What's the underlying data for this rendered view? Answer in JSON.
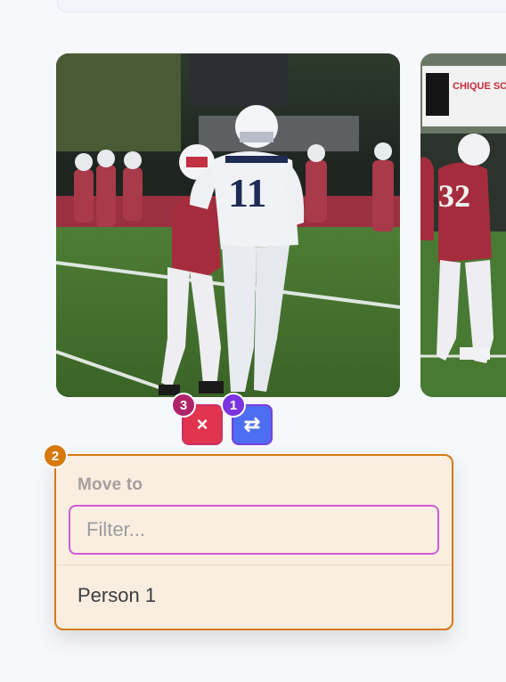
{
  "gallery": {
    "photos": [
      {
        "icon": "football-players-photo"
      },
      {
        "icon": "football-players-photo-partial",
        "banner_text": "CHIQUE SCH"
      }
    ]
  },
  "actions": {
    "remove_symbol": "×",
    "swap_symbol": "⇄",
    "remove_badge": "3",
    "swap_badge": "1"
  },
  "move_menu": {
    "badge": "2",
    "heading": "Move to",
    "filter_value": "",
    "filter_placeholder": "Filter...",
    "items": [
      {
        "label": "Person 1"
      }
    ]
  },
  "colors": {
    "remove": "#e0344f",
    "swap": "#4d6ef0",
    "menu_border": "#d8790f",
    "menu_bg": "#faeee0",
    "filter_border": "#d05ad6"
  }
}
